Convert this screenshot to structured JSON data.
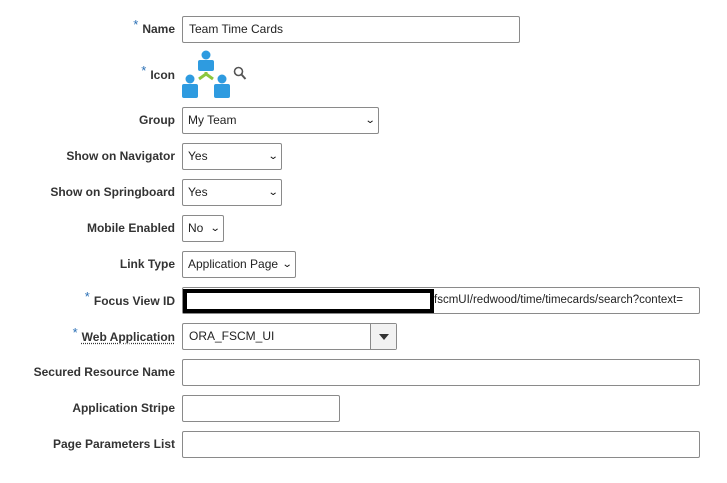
{
  "fields": {
    "name": {
      "label": "Name",
      "required": true,
      "value": "Team Time Cards"
    },
    "icon": {
      "label": "Icon",
      "required": true,
      "icon": "team-hierarchy-icon",
      "search_icon": "magnifier-icon"
    },
    "group": {
      "label": "Group",
      "value": "My Team"
    },
    "show_on_navigator": {
      "label": "Show on Navigator",
      "value": "Yes"
    },
    "show_on_springboard": {
      "label": "Show on Springboard",
      "value": "Yes"
    },
    "mobile_enabled": {
      "label": "Mobile Enabled",
      "value": "No"
    },
    "link_type": {
      "label": "Link Type",
      "value": "Application Page"
    },
    "focus_view_id": {
      "label": "Focus View ID",
      "required": true,
      "value": "fscmUI/redwood/time/timecards/search?context="
    },
    "web_application": {
      "label": "Web Application",
      "required": true,
      "value": "ORA_FSCM_UI"
    },
    "secured_resource_name": {
      "label": "Secured Resource Name",
      "value": ""
    },
    "application_stripe": {
      "label": "Application Stripe",
      "value": ""
    },
    "page_parameters_list": {
      "label": "Page Parameters List",
      "value": ""
    }
  },
  "colors": {
    "required_marker": "#2a6fb5",
    "icon_blue": "#2e9be0",
    "icon_green": "#8cc63f"
  }
}
